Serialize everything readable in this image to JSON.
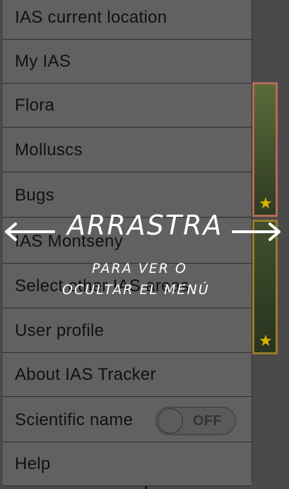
{
  "menu": {
    "items": [
      {
        "label": "IAS current location"
      },
      {
        "label": "My IAS"
      },
      {
        "label": "Flora"
      },
      {
        "label": "Molluscs"
      },
      {
        "label": "Bugs"
      },
      {
        "label": "IAS Montseny"
      },
      {
        "label": "Select other IAS areas"
      },
      {
        "label": "User profile"
      },
      {
        "label": "About IAS Tracker"
      },
      {
        "label": "Scientific name"
      },
      {
        "label": "Help"
      }
    ],
    "scientific_toggle": {
      "state": "OFF"
    }
  },
  "overlay": {
    "title": "ARRASTRA",
    "line1": "PARA VER O",
    "line2": "OCULTAR EL MENÚ"
  },
  "colors": {
    "overlay_text": "#ffffff",
    "menu_bg": "#616161",
    "star": "#d9b400"
  }
}
